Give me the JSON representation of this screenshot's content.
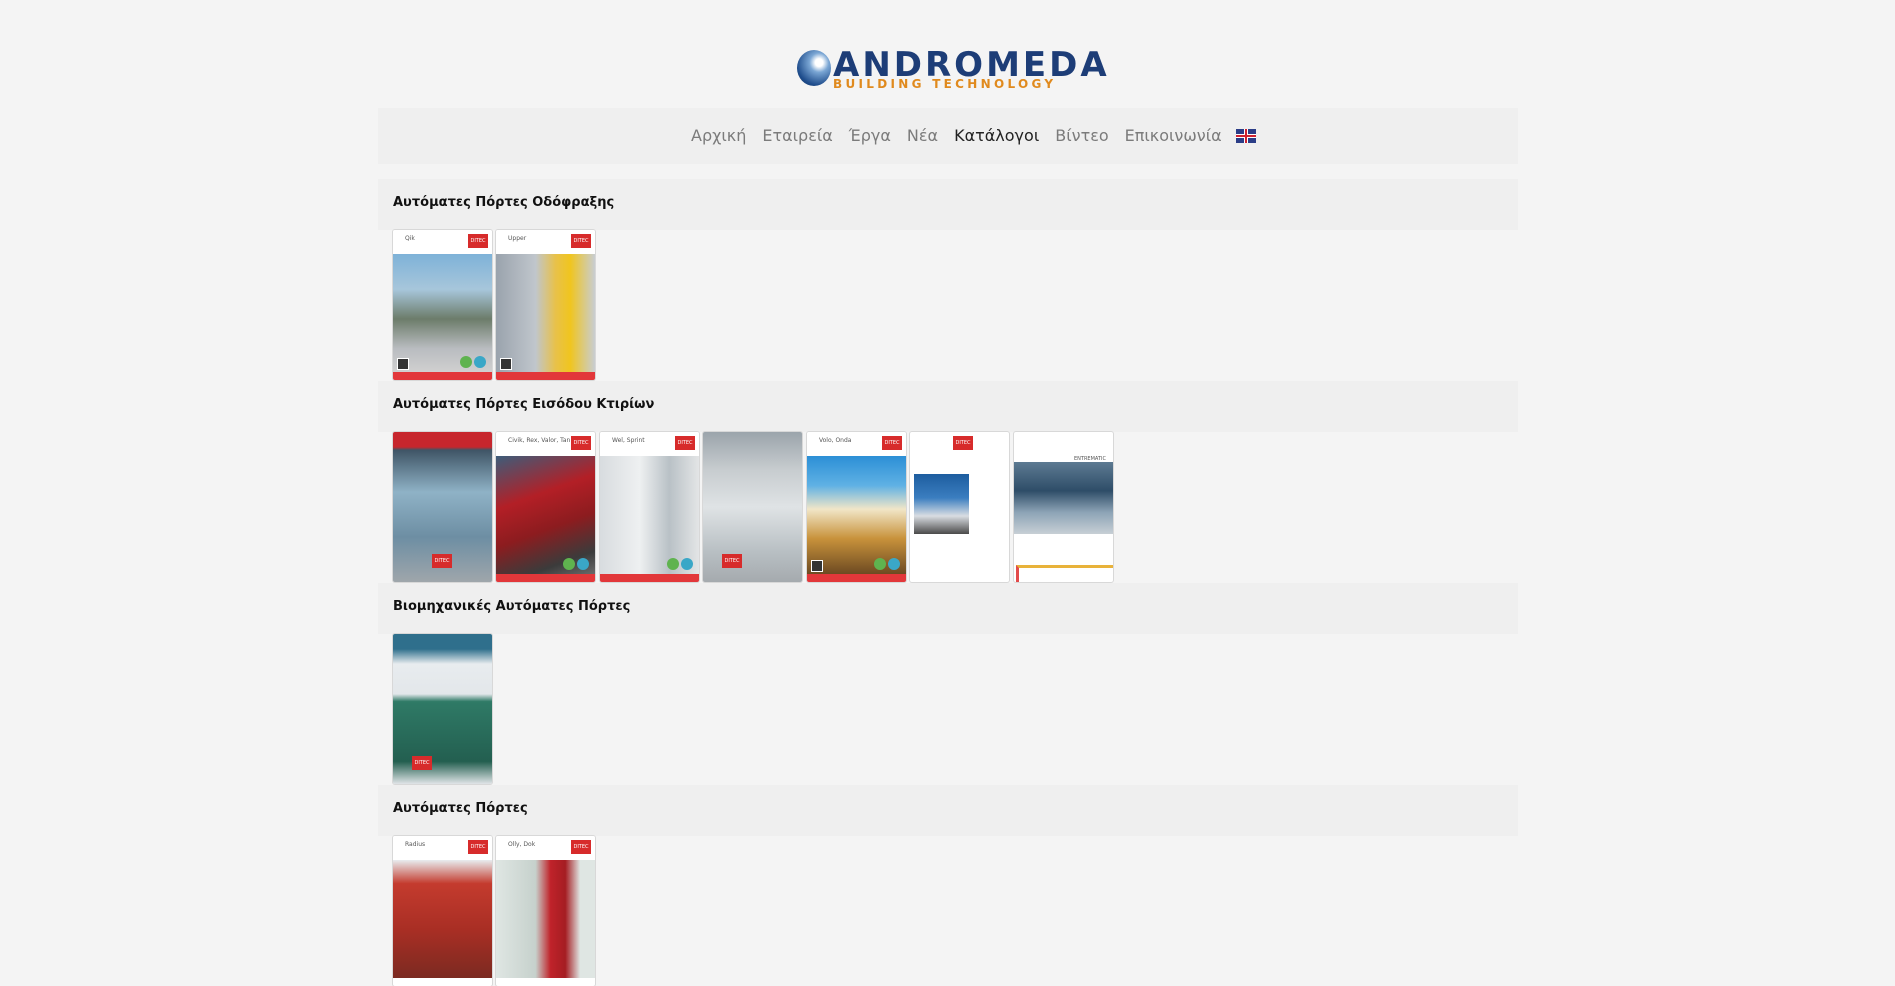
{
  "brand": {
    "name": "ANDROMEDA",
    "tagline": "BUILDING TECHNOLOGY",
    "colors": {
      "primary": "#1d3d77",
      "accent": "#e08a1e"
    }
  },
  "nav": {
    "items": [
      "Αρχική",
      "Εταιρεία",
      "Έργα",
      "Νέα",
      "Κατάλογοι",
      "Βίντεο",
      "Επικοινωνία"
    ],
    "active": "Κατάλογοι",
    "language_icon": "uk-flag-icon"
  },
  "sections": [
    {
      "title": "Αυτόματες Πόρτες Οδόφραξης",
      "catalogs": [
        {
          "caption": "Qik",
          "brand": "DITEC"
        },
        {
          "caption": "Upper",
          "brand": "DITEC"
        }
      ]
    },
    {
      "title": "Αυτόματες Πόρτες Εισόδου Κτιρίων",
      "catalogs": [
        {
          "caption": "",
          "brand": "DITEC"
        },
        {
          "caption": "Civik, Rex, Valor, Tan",
          "brand": "DITEC"
        },
        {
          "caption": "Wel, Sprint",
          "brand": "DITEC"
        },
        {
          "caption": "",
          "brand": "DITEC"
        },
        {
          "caption": "Volo, Onda",
          "brand": "DITEC"
        },
        {
          "caption": "",
          "brand": "DITEC"
        },
        {
          "caption": "",
          "brand": "ENTREMATIC"
        }
      ]
    },
    {
      "title": "Βιομηχανικές Αυτόματες Πόρτες",
      "catalogs": [
        {
          "caption": "",
          "brand": "DITEC"
        }
      ]
    },
    {
      "title": "Αυτόματες Πόρτες",
      "catalogs": [
        {
          "caption": "Radius",
          "brand": "DITEC"
        },
        {
          "caption": "Olly, Dok",
          "brand": "DITEC"
        }
      ]
    }
  ]
}
